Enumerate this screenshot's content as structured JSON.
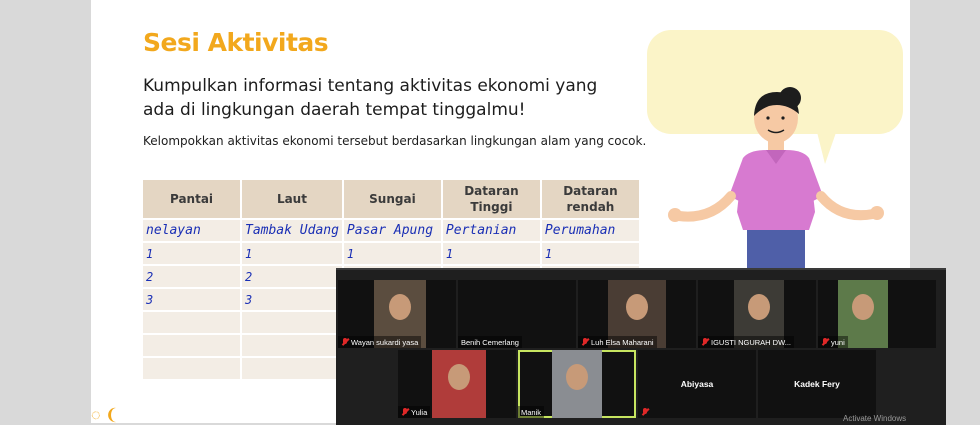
{
  "slide": {
    "title": "Sesi Aktivitas",
    "heading": "Kumpulkan informasi tentang aktivitas ekonomi yang ada di lingkungan daerah tempat tinggalmu!",
    "instruction": "Kelompokkan aktivitas ekonomi tersebut berdasarkan lingkungan alam yang cocok.",
    "table": {
      "headers": [
        "Pantai",
        "Laut",
        "Sungai",
        "Dataran Tinggi",
        "Dataran rendah"
      ],
      "rows": [
        [
          "nelayan",
          "Tambak Udang",
          "Pasar Apung",
          "Pertanian",
          "Perumahan"
        ],
        [
          "1",
          "1",
          "1",
          "1",
          "1"
        ],
        [
          "2",
          "2",
          "",
          "",
          ""
        ],
        [
          "3",
          "3",
          "",
          "",
          ""
        ],
        [
          "",
          "",
          "",
          "",
          ""
        ],
        [
          "",
          "",
          "",
          "",
          ""
        ],
        [
          "",
          "",
          "",
          "",
          ""
        ]
      ]
    }
  },
  "meeting": {
    "participants": [
      {
        "name": "Wayan sukardi yasa",
        "muted": true,
        "bg": "#5b4d3f"
      },
      {
        "name": "Benih Cemerlang",
        "muted": false,
        "bg": "#7b7468"
      },
      {
        "name": "Luh Elsa Maharani",
        "muted": true,
        "bg": "#4a3d34"
      },
      {
        "name": "IGUSTI NGURAH DW...",
        "muted": true,
        "bg": "#3d3b36"
      },
      {
        "name": "yuni",
        "muted": true,
        "bg": "#5d7a4a"
      },
      {
        "name": "Yulia",
        "muted": true,
        "bg": "#b03c3a"
      },
      {
        "name": "Manik",
        "muted": false,
        "bg": "#8a8d92"
      },
      {
        "name": "Abiyasa",
        "muted": true,
        "bg": ""
      },
      {
        "name": "Kadek Fery",
        "muted": false,
        "bg": ""
      }
    ],
    "watermark": "Activate Windows"
  }
}
